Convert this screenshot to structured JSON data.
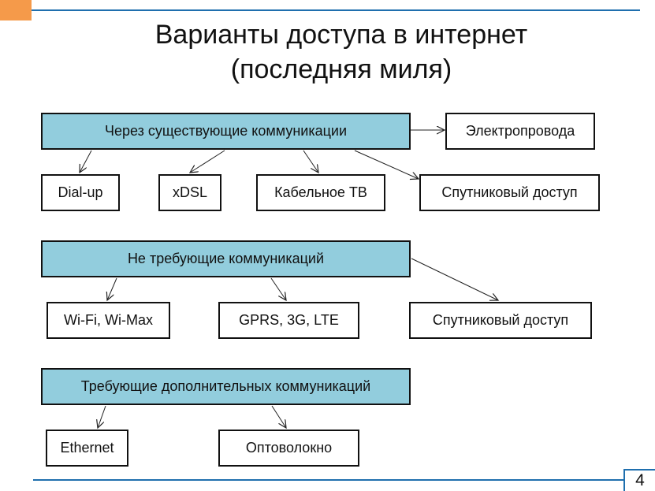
{
  "title_line1": "Варианты доступа в интернет",
  "title_line2": "(последняя миля)",
  "page_number": "4",
  "colors": {
    "accent_orange": "#f59a4a",
    "accent_blue": "#1f6fae",
    "category_fill": "#92cddd"
  },
  "groups": [
    {
      "category": "Через существующие коммуникации",
      "items": [
        "Электропровода",
        "Dial-up",
        "xDSL",
        "Кабельное ТВ",
        "Спутниковый доступ"
      ]
    },
    {
      "category": "Не требующие коммуникаций",
      "items": [
        "Wi-Fi, Wi-Max",
        "GPRS, 3G, LTE",
        "Спутниковый доступ"
      ]
    },
    {
      "category": "Требующие дополнительных коммуникаций",
      "items": [
        "Ethernet",
        "Оптоволокно"
      ]
    }
  ]
}
